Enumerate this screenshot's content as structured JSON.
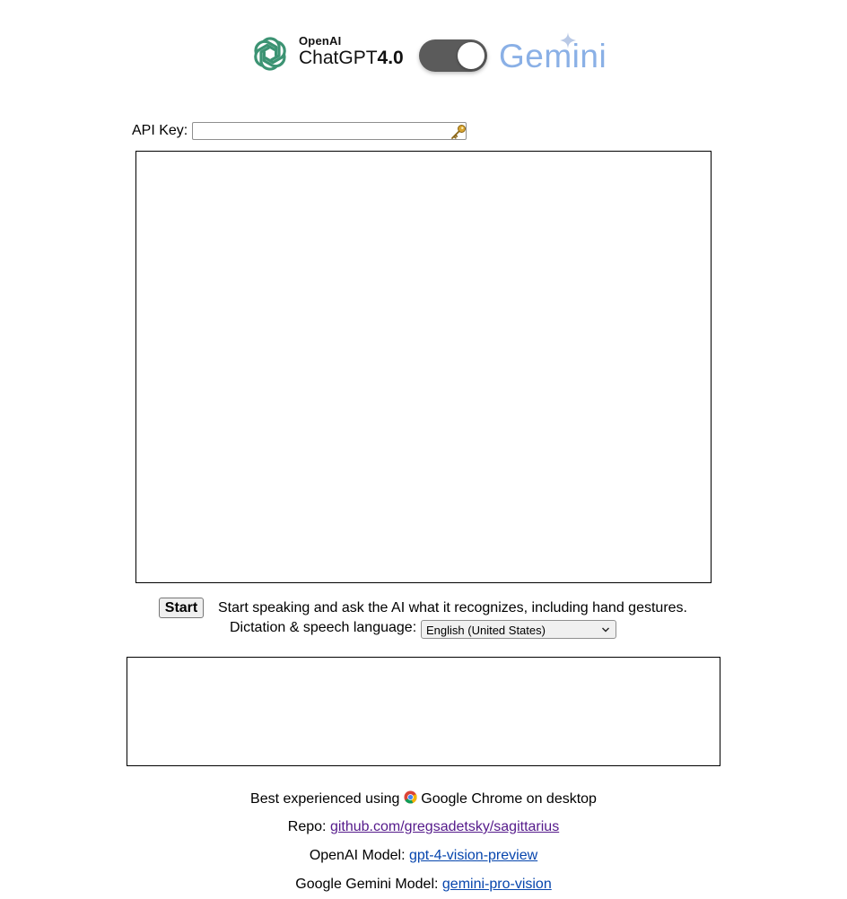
{
  "header": {
    "openai_brand": "OpenAI",
    "chatgpt_name": "ChatGPT",
    "chatgpt_version": "4.0",
    "toggle_state": "gemini",
    "gemini_brand": "Gemini",
    "icons": [
      "openai-logo-icon",
      "gemini-sparkle-icon"
    ],
    "colors": {
      "openai_logo": "#3c9373",
      "toggle_track": "#5b5b5b",
      "gemini": "#8ab0e6"
    }
  },
  "api": {
    "label": "API Key:",
    "value": "",
    "icon": "key-icon"
  },
  "controls": {
    "start_label": "Start",
    "instruction": "Start speaking and ask the AI what it recognizes, including hand gestures.",
    "language_label": "Dictation & speech language:",
    "language_selected": "English (United States)"
  },
  "footer": {
    "chrome_prefix": "Best experienced using",
    "chrome_suffix": "Google Chrome on desktop",
    "repo_label": "Repo:",
    "repo_link": "github.com/gregsadetsky/sagittarius",
    "openai_model_label": "OpenAI Model:",
    "openai_model_link": "gpt-4-vision-preview",
    "gemini_model_label": "Google Gemini Model:",
    "gemini_model_link": "gemini-pro-vision",
    "colors": {
      "visited_link": "#551a8b",
      "link": "#0645ad"
    }
  }
}
